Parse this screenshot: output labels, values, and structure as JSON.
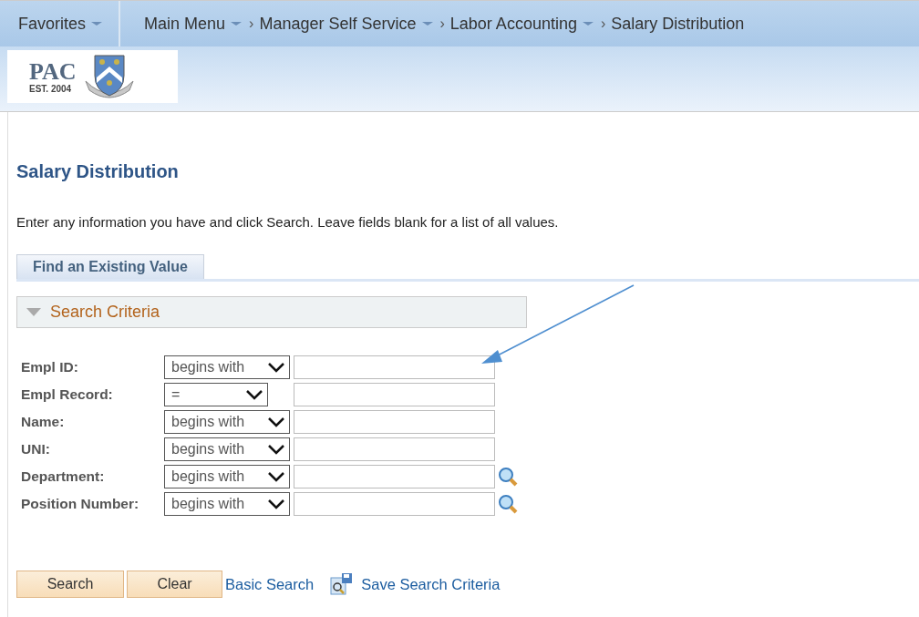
{
  "nav": [
    {
      "label": "Favorites",
      "dropdown": true
    },
    {
      "label": "Main Menu",
      "dropdown": true
    },
    {
      "separator": "›",
      "label": "Manager Self Service",
      "dropdown": true
    },
    {
      "separator": "›",
      "label": "Labor Accounting",
      "dropdown": true
    },
    {
      "separator": "›",
      "label": "Salary Distribution",
      "dropdown": false
    }
  ],
  "logo": {
    "name": "PAC",
    "established": "EST. 2004"
  },
  "page_title": "Salary Distribution",
  "instructions": "Enter any information you have and click Search. Leave fields blank for a list of all values.",
  "tabs": [
    {
      "label": "Find an Existing Value",
      "selected": true
    }
  ],
  "section": {
    "title": "Search Criteria",
    "expanded": true
  },
  "fields": [
    {
      "label": "Empl ID:",
      "operator": "begins with",
      "lookup": false
    },
    {
      "label": "Empl Record:",
      "operator": "=",
      "lookup": false
    },
    {
      "label": "Name:",
      "operator": "begins with",
      "lookup": false
    },
    {
      "label": "UNI:",
      "operator": "begins with",
      "lookup": false
    },
    {
      "label": "Department:",
      "operator": "begins with",
      "lookup": true
    },
    {
      "label": "Position Number:",
      "operator": "begins with",
      "lookup": true
    }
  ],
  "buttons": [
    "Search",
    "Clear"
  ],
  "links": [
    {
      "label": "Basic Search",
      "icon": false
    },
    {
      "label": "Save Search Criteria",
      "icon": true
    }
  ]
}
